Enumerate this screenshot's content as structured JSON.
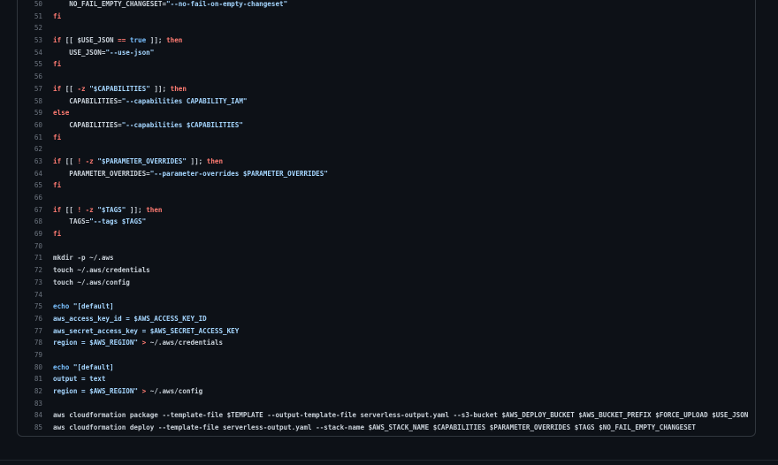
{
  "code_view": {
    "lines": [
      {
        "no": "50",
        "segs": [
          {
            "t": "    NO_FAIL_EMPTY_CHANGESET=",
            "c": "p"
          },
          {
            "t": "\"--no-fail-on-empty-changeset\"",
            "c": "s"
          }
        ]
      },
      {
        "no": "51",
        "segs": [
          {
            "t": "fi",
            "c": "k"
          }
        ]
      },
      {
        "no": "52",
        "segs": []
      },
      {
        "no": "53",
        "segs": [
          {
            "t": "if",
            "c": "k"
          },
          {
            "t": " [[ $USE_JSON ",
            "c": "p"
          },
          {
            "t": "==",
            "c": "k"
          },
          {
            "t": " ",
            "c": "p"
          },
          {
            "t": "true",
            "c": "b"
          },
          {
            "t": " ]]; ",
            "c": "p"
          },
          {
            "t": "then",
            "c": "k"
          }
        ]
      },
      {
        "no": "54",
        "segs": [
          {
            "t": "    USE_JSON=",
            "c": "p"
          },
          {
            "t": "\"--use-json\"",
            "c": "s"
          }
        ]
      },
      {
        "no": "55",
        "segs": [
          {
            "t": "fi",
            "c": "k"
          }
        ]
      },
      {
        "no": "56",
        "segs": []
      },
      {
        "no": "57",
        "segs": [
          {
            "t": "if",
            "c": "k"
          },
          {
            "t": " [[ ",
            "c": "p"
          },
          {
            "t": "-z",
            "c": "k"
          },
          {
            "t": " ",
            "c": "p"
          },
          {
            "t": "\"$CAPABILITIES\"",
            "c": "s"
          },
          {
            "t": " ]]; ",
            "c": "p"
          },
          {
            "t": "then",
            "c": "k"
          }
        ]
      },
      {
        "no": "58",
        "segs": [
          {
            "t": "    CAPABILITIES=",
            "c": "p"
          },
          {
            "t": "\"--capabilities CAPABILITY_IAM\"",
            "c": "s"
          }
        ]
      },
      {
        "no": "59",
        "segs": [
          {
            "t": "else",
            "c": "k"
          }
        ]
      },
      {
        "no": "60",
        "segs": [
          {
            "t": "    CAPABILITIES=",
            "c": "p"
          },
          {
            "t": "\"--capabilities $CAPABILITIES\"",
            "c": "s"
          }
        ]
      },
      {
        "no": "61",
        "segs": [
          {
            "t": "fi",
            "c": "k"
          }
        ]
      },
      {
        "no": "62",
        "segs": []
      },
      {
        "no": "63",
        "segs": [
          {
            "t": "if",
            "c": "k"
          },
          {
            "t": " [[ ",
            "c": "p"
          },
          {
            "t": "! -z",
            "c": "k"
          },
          {
            "t": " ",
            "c": "p"
          },
          {
            "t": "\"$PARAMETER_OVERRIDES\"",
            "c": "s"
          },
          {
            "t": " ]]; ",
            "c": "p"
          },
          {
            "t": "then",
            "c": "k"
          }
        ]
      },
      {
        "no": "64",
        "segs": [
          {
            "t": "    PARAMETER_OVERRIDES=",
            "c": "p"
          },
          {
            "t": "\"--parameter-overrides $PARAMETER_OVERRIDES\"",
            "c": "s"
          }
        ]
      },
      {
        "no": "65",
        "segs": [
          {
            "t": "fi",
            "c": "k"
          }
        ]
      },
      {
        "no": "66",
        "segs": []
      },
      {
        "no": "67",
        "segs": [
          {
            "t": "if",
            "c": "k"
          },
          {
            "t": " [[ ",
            "c": "p"
          },
          {
            "t": "! -z",
            "c": "k"
          },
          {
            "t": " ",
            "c": "p"
          },
          {
            "t": "\"$TAGS\"",
            "c": "s"
          },
          {
            "t": " ]]; ",
            "c": "p"
          },
          {
            "t": "then",
            "c": "k"
          }
        ]
      },
      {
        "no": "68",
        "segs": [
          {
            "t": "    TAGS=",
            "c": "p"
          },
          {
            "t": "\"--tags $TAGS\"",
            "c": "s"
          }
        ]
      },
      {
        "no": "69",
        "segs": [
          {
            "t": "fi",
            "c": "k"
          }
        ]
      },
      {
        "no": "70",
        "segs": []
      },
      {
        "no": "71",
        "segs": [
          {
            "t": "mkdir -p ~/.aws",
            "c": "p"
          }
        ]
      },
      {
        "no": "72",
        "segs": [
          {
            "t": "touch ~/.aws/credentials",
            "c": "p"
          }
        ]
      },
      {
        "no": "73",
        "segs": [
          {
            "t": "touch ~/.aws/config",
            "c": "p"
          }
        ]
      },
      {
        "no": "74",
        "segs": []
      },
      {
        "no": "75",
        "segs": [
          {
            "t": "echo",
            "c": "b"
          },
          {
            "t": " ",
            "c": "p"
          },
          {
            "t": "\"[default]",
            "c": "s"
          }
        ]
      },
      {
        "no": "76",
        "segs": [
          {
            "t": "aws_access_key_id = $AWS_ACCESS_KEY_ID",
            "c": "s"
          }
        ]
      },
      {
        "no": "77",
        "segs": [
          {
            "t": "aws_secret_access_key = $AWS_SECRET_ACCESS_KEY",
            "c": "s"
          }
        ]
      },
      {
        "no": "78",
        "segs": [
          {
            "t": "region = $AWS_REGION\"",
            "c": "s"
          },
          {
            "t": " ",
            "c": "p"
          },
          {
            "t": ">",
            "c": "k"
          },
          {
            "t": " ~/.aws/credentials",
            "c": "p"
          }
        ]
      },
      {
        "no": "79",
        "segs": []
      },
      {
        "no": "80",
        "segs": [
          {
            "t": "echo",
            "c": "b"
          },
          {
            "t": " ",
            "c": "p"
          },
          {
            "t": "\"[default]",
            "c": "s"
          }
        ]
      },
      {
        "no": "81",
        "segs": [
          {
            "t": "output = text",
            "c": "s"
          }
        ]
      },
      {
        "no": "82",
        "segs": [
          {
            "t": "region = $AWS_REGION\"",
            "c": "s"
          },
          {
            "t": " ",
            "c": "p"
          },
          {
            "t": ">",
            "c": "k"
          },
          {
            "t": " ~/.aws/config",
            "c": "p"
          }
        ]
      },
      {
        "no": "83",
        "segs": []
      },
      {
        "no": "84",
        "segs": [
          {
            "t": "aws cloudformation package --template-file $TEMPLATE --output-template-file serverless-output.yaml --s3-bucket $AWS_DEPLOY_BUCKET $AWS_BUCKET_PREFIX $FORCE_UPLOAD $USE_JSON",
            "c": "p"
          }
        ]
      },
      {
        "no": "85",
        "segs": [
          {
            "t": "aws cloudformation deploy --template-file serverless-output.yaml --stack-name $AWS_STACK_NAME $CAPABILITIES $PARAMETER_OVERRIDES $TAGS $NO_FAIL_EMPTY_CHANGESET",
            "c": "p"
          }
        ]
      }
    ]
  }
}
